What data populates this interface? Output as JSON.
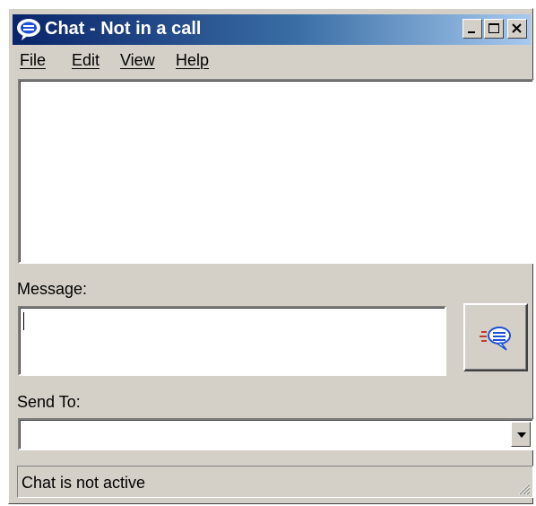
{
  "window": {
    "title": "Chat - Not in a call",
    "title_icon": "chat-bubble-icon",
    "controls": {
      "minimize": "minimize-icon",
      "maximize": "maximize-icon",
      "close": "close-icon"
    }
  },
  "menu": {
    "items": [
      {
        "label": "File"
      },
      {
        "label": "Edit"
      },
      {
        "label": "View"
      },
      {
        "label": "Help"
      }
    ]
  },
  "chat_log": {
    "messages": []
  },
  "message": {
    "label": "Message:",
    "value": ""
  },
  "send_button": {
    "icon": "send-message-icon"
  },
  "send_to": {
    "label": "Send To:",
    "selected": ""
  },
  "status": {
    "text": "Chat is not active"
  },
  "colors": {
    "title_gradient_start": "#0a246a",
    "title_gradient_end": "#a6caf0",
    "window_face": "#d4d0c8",
    "icon_blue": "#1c4fd8",
    "accent_red": "#c0392b"
  }
}
